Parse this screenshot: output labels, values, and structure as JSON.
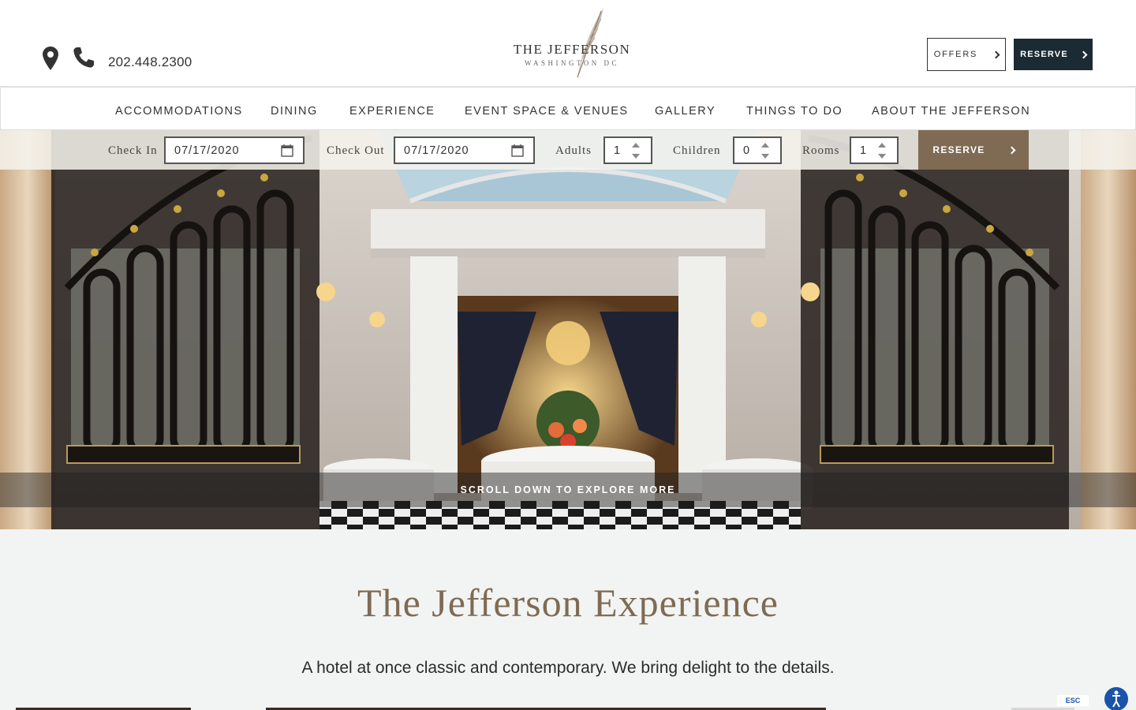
{
  "header": {
    "phone": "202.448.2300",
    "logo_name": "THE JEFFERSON",
    "logo_city": "WASHINGTON DC",
    "offers_label": "OFFERS",
    "reserve_label": "RESERVE",
    "icons": [
      "map-pin-icon",
      "phone-icon",
      "chevron-right-icon"
    ]
  },
  "nav": {
    "items": [
      "ACCOMMODATIONS",
      "DINING",
      "EXPERIENCE",
      "EVENT SPACE & VENUES",
      "GALLERY",
      "THINGS TO DO",
      "ABOUT THE JEFFERSON"
    ]
  },
  "booking": {
    "check_in_label": "Check In",
    "check_in_value": "07/17/2020",
    "check_out_label": "Check Out",
    "check_out_value": "07/17/2020",
    "adults_label": "Adults",
    "adults_value": "1",
    "children_label": "Children",
    "children_value": "0",
    "rooms_label": "Rooms",
    "rooms_value": "1",
    "reserve_label": "RESERVE"
  },
  "hero": {
    "scroll_text": "SCROLL DOWN TO EXPLORE MORE"
  },
  "intro": {
    "title": "The Jefferson Experience",
    "text": "A hotel at once classic and contemporary. We bring delight to the details."
  },
  "accessibility": {
    "esc_label": "ESC"
  },
  "colors": {
    "brand_dark": "#1c2a33",
    "brand_bronze": "#7f6b53",
    "accessibility_blue": "#1a54a8"
  }
}
